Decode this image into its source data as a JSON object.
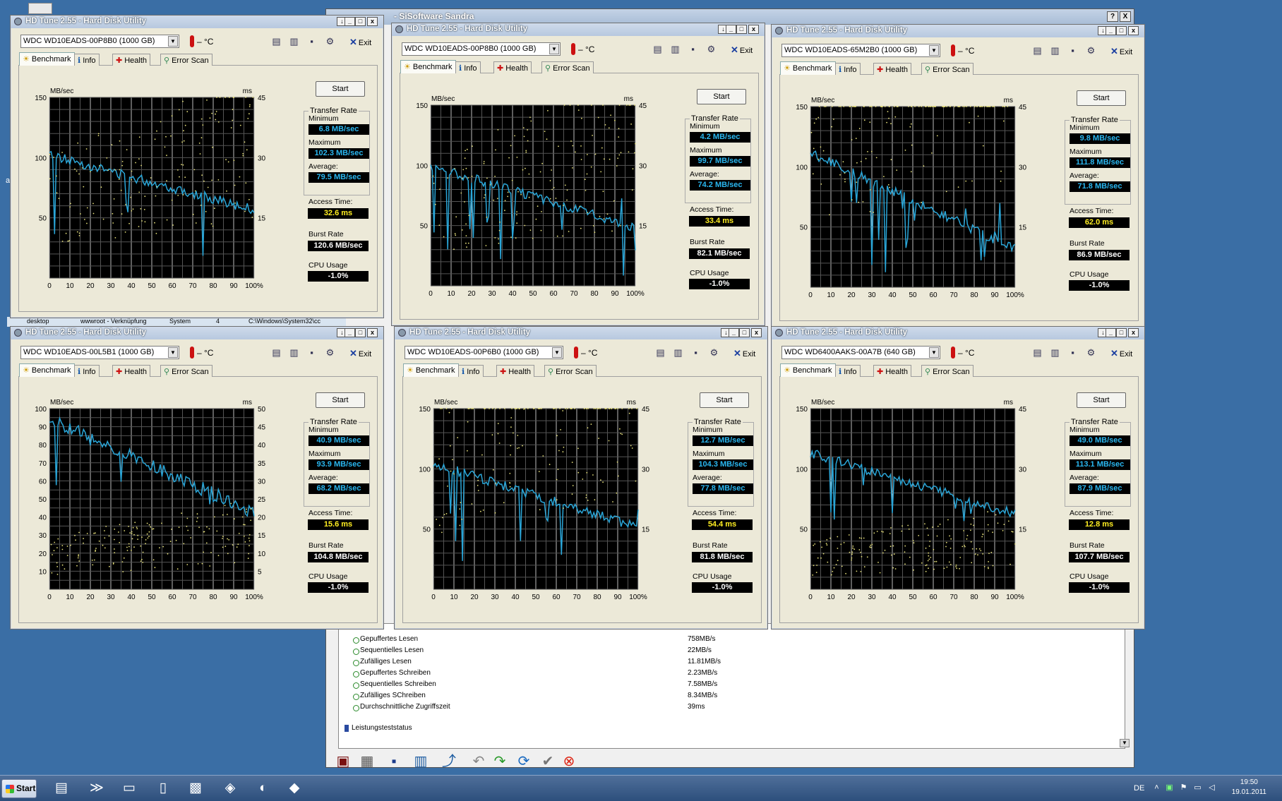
{
  "sandra": {
    "title": "- SiSoftware Sandra",
    "help_btn": "?",
    "close_btn": "X",
    "results": [
      {
        "label": "Gepuffertes Lesen",
        "value": "758MB/s"
      },
      {
        "label": "Sequentielles Lesen",
        "value": "22MB/s"
      },
      {
        "label": "Zufälliges Lesen",
        "value": "11.81MB/s"
      },
      {
        "label": "Gepuffertes Schreiben",
        "value": "2.23MB/s"
      },
      {
        "label": "Sequentielles Schreiben",
        "value": "7.58MB/s"
      },
      {
        "label": "Zufälliges SChreiben",
        "value": "8.34MB/s"
      },
      {
        "label": "Durchschnittliche Zugriffszeit",
        "value": "39ms"
      }
    ],
    "status_label": "Leistungsteststatus"
  },
  "bg_strip": {
    "c1": "desktop",
    "c2": "wwwroot - Verknüpfung",
    "c3": "System",
    "c4": "4",
    "c5": "C:\\Windows\\System32\\cc"
  },
  "common": {
    "app_title": "HD Tune 2.55 - Hard Disk Utility",
    "temp": "– °C",
    "exit": "Exit",
    "start": "Start",
    "tabs": [
      "Benchmark",
      "Info",
      "Health",
      "Error Scan"
    ],
    "tab_icons": [
      "bench-icon",
      "info-icon",
      "health-icon",
      "errorscan-icon"
    ],
    "transfer_rate": "Transfer Rate",
    "minimum": "Minimum",
    "maximum": "Maximum",
    "average": "Average:",
    "access_time": "Access Time:",
    "burst_rate": "Burst Rate",
    "cpu_usage": "CPU Usage",
    "left_unit": "MB/sec",
    "right_unit": "ms",
    "x_ticks": [
      "0",
      "10",
      "20",
      "30",
      "40",
      "50",
      "60",
      "70",
      "80",
      "90",
      "100%"
    ],
    "line_color": "#2aa6d8",
    "dot_color": "#e6e07a"
  },
  "windows": [
    {
      "drive": "WDC WD10EADS-00P8B0 (1000 GB)",
      "min": "6.8 MB/sec",
      "max": "102.3 MB/sec",
      "avg": "79.5 MB/sec",
      "access": "32.6 ms",
      "burst": "120.6 MB/sec",
      "cpu": "-1.0%",
      "y_ticks_left": [
        "150",
        "100",
        "50"
      ],
      "y_ticks_right": [
        "45",
        "30",
        "15"
      ]
    },
    {
      "drive": "WDC WD10EADS-00P8B0 (1000 GB)",
      "min": "4.2 MB/sec",
      "max": "99.7 MB/sec",
      "avg": "74.2 MB/sec",
      "access": "33.4 ms",
      "burst": "82.1 MB/sec",
      "cpu": "-1.0%",
      "y_ticks_left": [
        "150",
        "100",
        "50"
      ],
      "y_ticks_right": [
        "45",
        "30",
        "15"
      ]
    },
    {
      "drive": "WDC WD10EADS-65M2B0 (1000 GB)",
      "min": "9.8 MB/sec",
      "max": "111.8 MB/sec",
      "avg": "71.8 MB/sec",
      "access": "62.0 ms",
      "burst": "86.9 MB/sec",
      "cpu": "-1.0%",
      "y_ticks_left": [
        "150",
        "100",
        "50"
      ],
      "y_ticks_right": [
        "45",
        "30",
        "15"
      ]
    },
    {
      "drive": "WDC WD10EADS-00L5B1 (1000 GB)",
      "min": "40.9 MB/sec",
      "max": "93.9 MB/sec",
      "avg": "68.2 MB/sec",
      "access": "15.6 ms",
      "burst": "104.8 MB/sec",
      "cpu": "-1.0%",
      "y_ticks_left": [
        "100",
        "90",
        "80",
        "70",
        "60",
        "50",
        "40",
        "30",
        "20",
        "10"
      ],
      "y_ticks_right": [
        "50",
        "45",
        "40",
        "35",
        "30",
        "25",
        "20",
        "15",
        "10",
        "5"
      ]
    },
    {
      "drive": "WDC WD10EADS-00P6B0 (1000 GB)",
      "min": "12.7 MB/sec",
      "max": "104.3 MB/sec",
      "avg": "77.8 MB/sec",
      "access": "54.4 ms",
      "burst": "81.8 MB/sec",
      "cpu": "-1.0%",
      "y_ticks_left": [
        "150",
        "100",
        "50"
      ],
      "y_ticks_right": [
        "45",
        "30",
        "15"
      ]
    },
    {
      "drive": "WDC WD6400AAKS-00A7B (640 GB)",
      "min": "49.0 MB/sec",
      "max": "113.1 MB/sec",
      "avg": "87.9 MB/sec",
      "access": "12.8 ms",
      "burst": "107.7 MB/sec",
      "cpu": "-1.0%",
      "y_ticks_left": [
        "150",
        "100",
        "50"
      ],
      "y_ticks_right": [
        "45",
        "30",
        "15"
      ]
    }
  ],
  "taskbar": {
    "start": "Start",
    "lang": "DE",
    "time": "19:50",
    "date": "19.01.2011"
  }
}
